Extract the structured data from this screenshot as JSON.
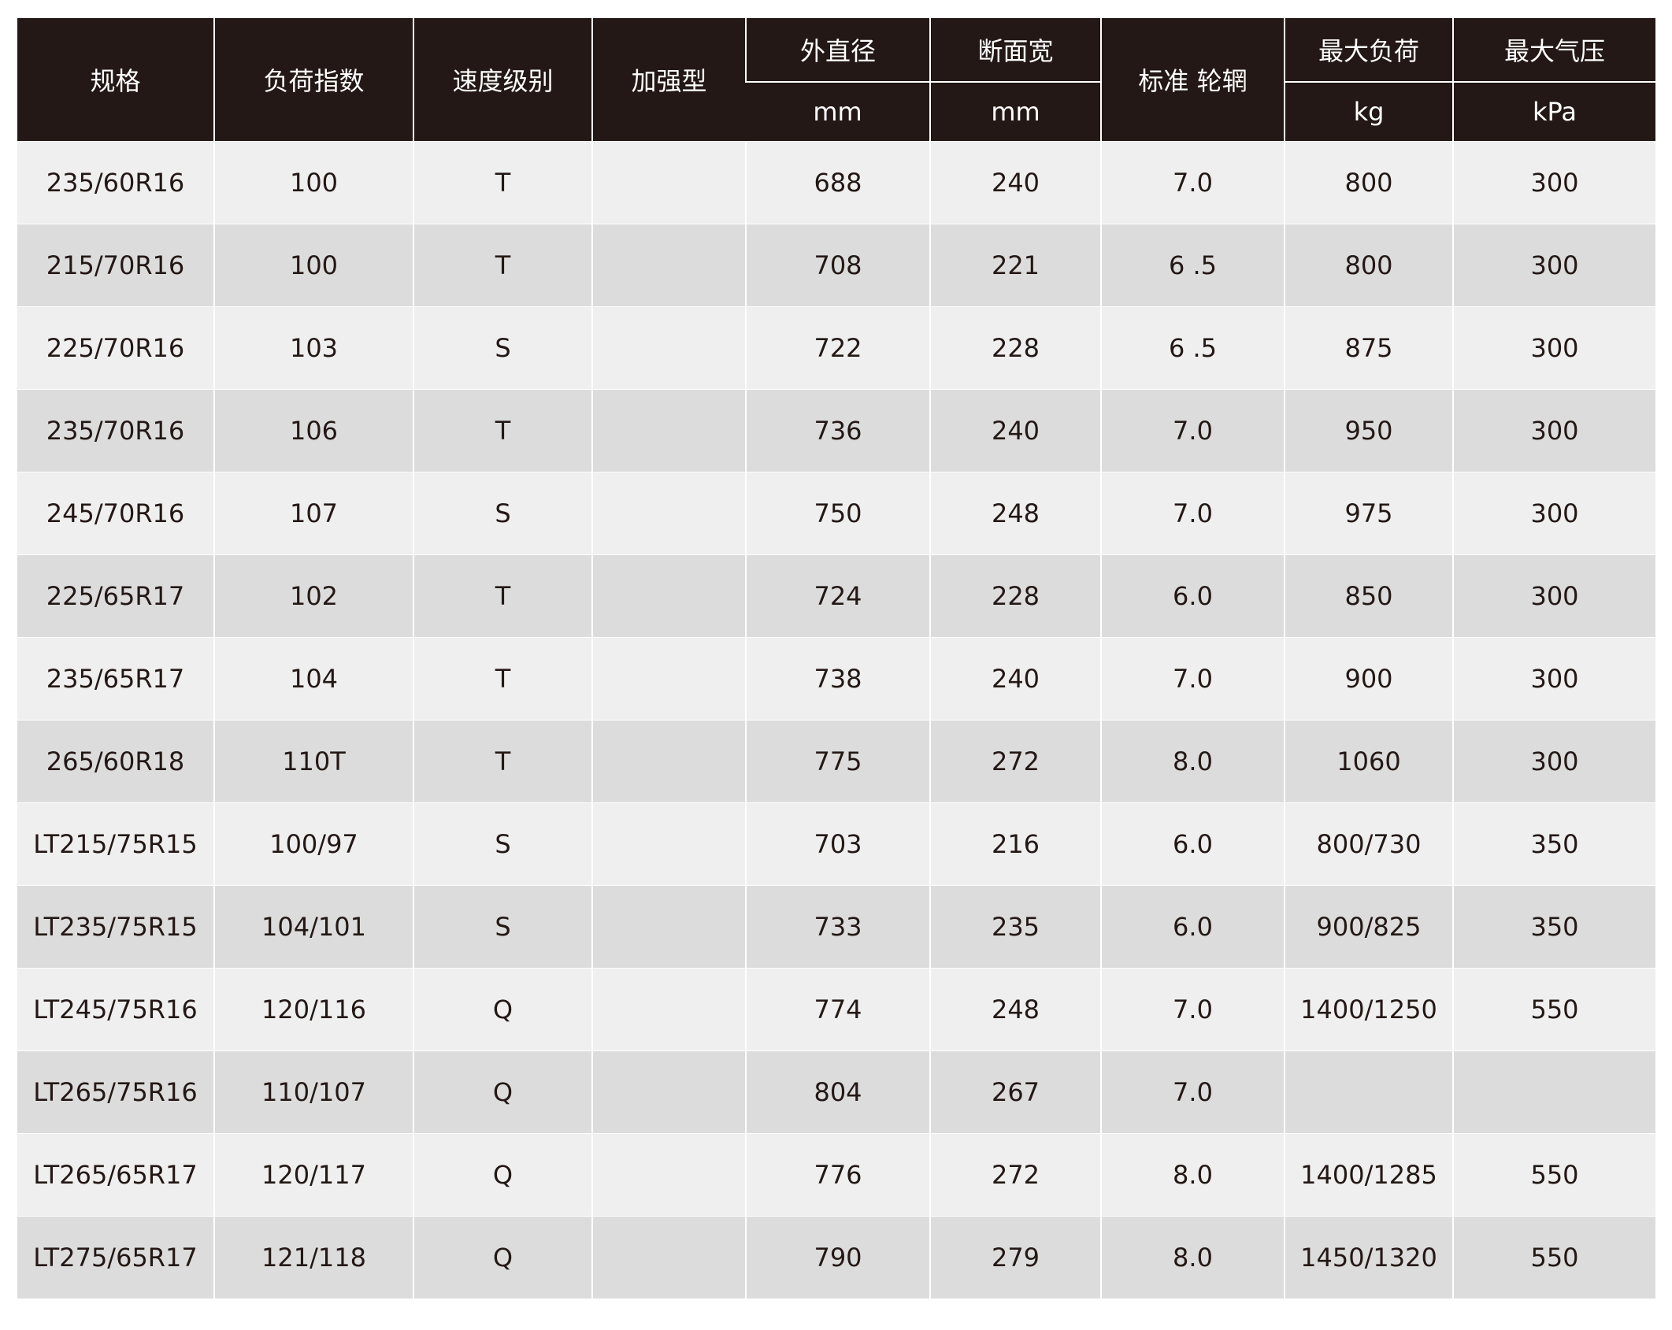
{
  "headers": {
    "spec": "规格",
    "load_index": "负荷指数",
    "speed_rating": "速度级别",
    "reinforced": "加强型",
    "outer_diameter": "外直径",
    "section_width": "断面宽",
    "standard_rim": "标准 轮辋",
    "max_load": "最大负荷",
    "max_pressure": "最大气压"
  },
  "units": {
    "outer_diameter": "mm",
    "section_width": "mm",
    "max_load": "kg",
    "max_pressure": "kPa"
  },
  "rows": [
    [
      "235/60R16",
      "100",
      "T",
      "",
      "688",
      "240",
      "7.0",
      "800",
      "300"
    ],
    [
      "215/70R16",
      "100",
      "T",
      "",
      "708",
      "221",
      "6 .5",
      "800",
      "300"
    ],
    [
      "225/70R16",
      "103",
      "S",
      "",
      "722",
      "228",
      "6 .5",
      "875",
      "300"
    ],
    [
      "235/70R16",
      "106",
      "T",
      "",
      "736",
      "240",
      "7.0",
      "950",
      "300"
    ],
    [
      "245/70R16",
      "107",
      "S",
      "",
      "750",
      "248",
      "7.0",
      "975",
      "300"
    ],
    [
      "225/65R17",
      "102",
      "T",
      "",
      "724",
      "228",
      "6.0",
      "850",
      "300"
    ],
    [
      "235/65R17",
      "104",
      "T",
      "",
      "738",
      "240",
      "7.0",
      "900",
      "300"
    ],
    [
      "265/60R18",
      "110T",
      "T",
      "",
      "775",
      "272",
      "8.0",
      "1060",
      "300"
    ],
    [
      "LT215/75R15",
      "100/97",
      "S",
      "",
      "703",
      "216",
      "6.0",
      "800/730",
      "350"
    ],
    [
      "LT235/75R15",
      "104/101",
      "S",
      "",
      "733",
      "235",
      "6.0",
      "900/825",
      "350"
    ],
    [
      "LT245/75R16",
      "120/116",
      "Q",
      "",
      "774",
      "248",
      "7.0",
      "1400/1250",
      "550"
    ],
    [
      "LT265/75R16",
      "110/107",
      "Q",
      "",
      "804",
      "267",
      "7.0",
      "",
      ""
    ],
    [
      "LT265/65R17",
      "120/117",
      "Q",
      "",
      "776",
      "272",
      "8.0",
      "1400/1285",
      "550"
    ],
    [
      "LT275/65R17",
      "121/118",
      "Q",
      "",
      "790",
      "279",
      "8.0",
      "1450/1320",
      "550"
    ]
  ]
}
